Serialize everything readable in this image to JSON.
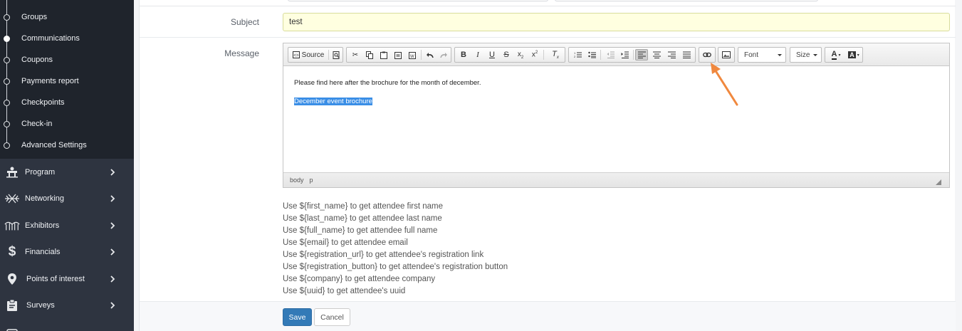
{
  "sidebar": {
    "sub_items": [
      {
        "label": "Groups",
        "active": false
      },
      {
        "label": "Communications",
        "active": true
      },
      {
        "label": "Coupons",
        "active": false
      },
      {
        "label": "Payments report",
        "active": false
      },
      {
        "label": "Checkpoints",
        "active": false
      },
      {
        "label": "Check-in",
        "active": false
      },
      {
        "label": "Advanced Settings",
        "active": false
      }
    ],
    "items": [
      {
        "label": "Program",
        "icon": "program-icon"
      },
      {
        "label": "Networking",
        "icon": "networking-icon"
      },
      {
        "label": "Exhibitors",
        "icon": "exhibitors-icon"
      },
      {
        "label": "Financials",
        "icon": "dollar-icon"
      },
      {
        "label": "Points of interest",
        "icon": "map-pin-icon"
      },
      {
        "label": "Surveys",
        "icon": "clipboard-icon"
      }
    ]
  },
  "form": {
    "subject_label": "Subject",
    "subject_value": "test",
    "message_label": "Message"
  },
  "editor": {
    "source_label": "Source",
    "font_label": "Font",
    "size_label": "Size",
    "body_paragraph": "Please find here after the brochure for the month of december.",
    "selected_text": "December event brochure",
    "path": [
      "body",
      "p"
    ]
  },
  "hints": [
    "Use ${first_name} to get attendee first name",
    "Use ${last_name} to get attendee last name",
    "Use ${full_name} to get attendee full name",
    "Use ${email} to get attendee email",
    "Use ${registration_url} to get attendee's registration link",
    "Use ${registration_button} to get attendee's registration button",
    "Use ${company} to get attendee company",
    "Use ${uuid} to get attendee's uuid"
  ],
  "buttons": {
    "save": "Save",
    "cancel": "Cancel"
  },
  "colors": {
    "sidebar_bg": "#2e3440",
    "subnav_bg": "#1f242c",
    "subject_bg": "#ffffe0",
    "primary": "#337ab7",
    "selection": "#3a8ee6",
    "annotation_arrow": "#f0883e"
  }
}
